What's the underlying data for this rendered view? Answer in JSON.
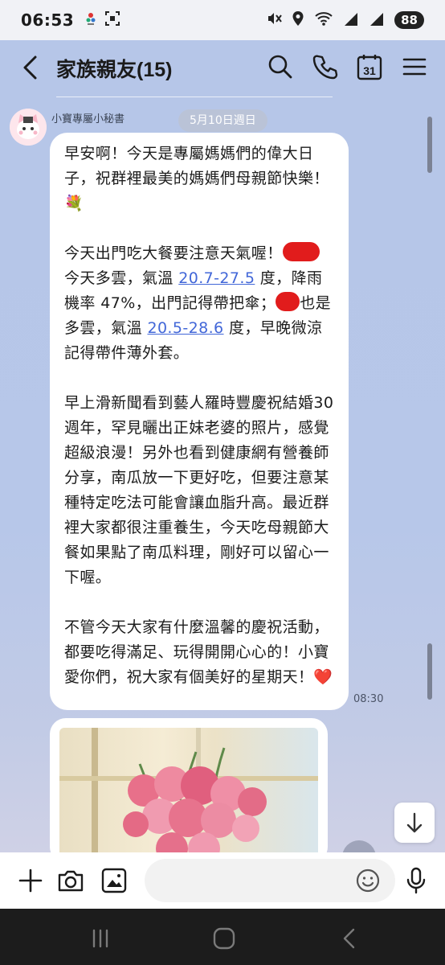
{
  "status_bar": {
    "time": "06:53",
    "battery": "88"
  },
  "header": {
    "title": "家族親友(15)",
    "calendar_day": "31",
    "icons": [
      "back-chevron-icon",
      "search-icon",
      "phone-icon",
      "calendar-icon",
      "menu-icon"
    ]
  },
  "message": {
    "sender": "小寶專屬小秘書",
    "date": "5月10日週日",
    "time": "08:30",
    "p1": "早安啊！今天是專屬媽媽們的偉大日子，祝群裡最美的媽媽們母親節快樂！💐",
    "p2_a": "今天出門吃大餐要注意天氣喔！",
    "p2_b": "今天多雲，氣溫 ",
    "p2_temp1": "20.7-27.5",
    "p2_c": " 度，降雨機率 47%，出門記得帶把傘；",
    "p2_d": "也是多雲，氣溫 ",
    "p2_temp2": "20.5-28.6",
    "p2_e": " 度，早晚微涼記得帶件薄外套。",
    "p3": "早上滑新聞看到藝人羅時豐慶祝結婚30週年，罕見曬出正妹老婆的照片，感覺超級浪漫！另外也看到健康網有營養師分享，南瓜放一下更好吃，但要注意某種特定吃法可能會讓血脂升高。最近群裡大家都很注重養生，今天吃母親節大餐如果點了南瓜料理，剛好可以留心一下喔。",
    "p4": "不管今天大家有什麼溫馨的慶祝活動，都要吃得滿足、玩得開開心心的！小寶愛你們，祝大家有個美好的星期天！❤️"
  },
  "input_bar": {
    "placeholder": "",
    "icons": [
      "plus-icon",
      "camera-icon",
      "image-icon",
      "emoji-icon",
      "mic-icon"
    ]
  },
  "colors": {
    "chat_bg": "#b6c6e8",
    "link": "#4267d8",
    "redaction": "#e11c1c"
  }
}
